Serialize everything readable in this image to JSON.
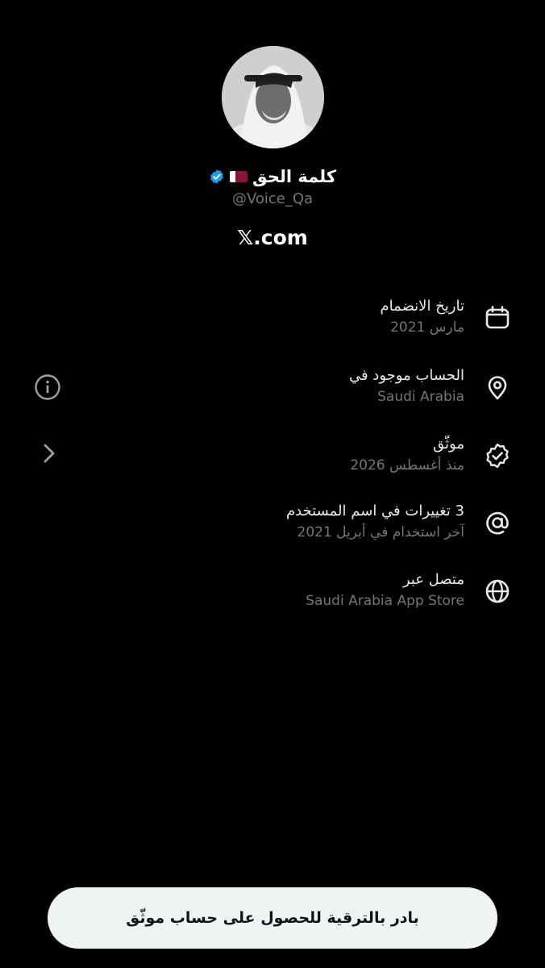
{
  "profile": {
    "display_name": "كلمة الحق",
    "handle": "@Voice_Qa",
    "flag_icon": "qatar-flag-icon",
    "verified_icon": "verified-badge-icon",
    "verified_color": "#1d9bf0"
  },
  "site": {
    "label": "𝕏.com"
  },
  "info": [
    {
      "title": "تاريخ الانضمام",
      "sub": "مارس 2021",
      "icon": "calendar-icon"
    },
    {
      "title": "الحساب موجود في",
      "sub": "Saudi Arabia",
      "icon": "location-pin-icon"
    },
    {
      "title": "موثّق",
      "sub": "منذ أغسطس 2026",
      "icon": "verified-check-icon"
    },
    {
      "title": "3 تغييرات في اسم المستخدم",
      "sub": "آخر استخدام في أبريل 2021",
      "icon": "at-sign-icon"
    },
    {
      "title": "متصل عبر",
      "sub": "Saudi Arabia App Store",
      "icon": "globe-icon"
    }
  ],
  "side_icons": {
    "info": "info-icon",
    "chevron": "chevron-right-icon"
  },
  "cta": {
    "label": "بادر بالترقية للحصول على حساب موثّق"
  },
  "colors": {
    "background": "#000000",
    "primary_text": "#e7e9ea",
    "secondary_text": "#71767b",
    "cta_bg": "#eff3f4"
  }
}
